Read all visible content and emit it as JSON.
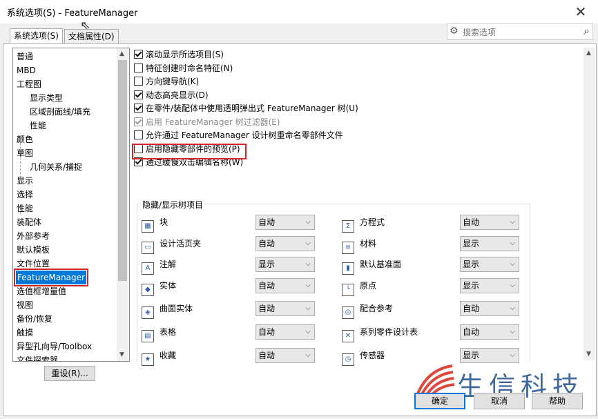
{
  "window": {
    "title": "系统选项(S) - FeatureManager"
  },
  "tabs": [
    {
      "label": "系统选项(S)",
      "active": true
    },
    {
      "label": "文档属性(D)",
      "active": false
    }
  ],
  "search": {
    "placeholder": "搜索选项"
  },
  "nav": {
    "items": [
      {
        "label": "普通",
        "sub": false
      },
      {
        "label": "MBD",
        "sub": false
      },
      {
        "label": "工程图",
        "sub": false
      },
      {
        "label": "显示类型",
        "sub": true
      },
      {
        "label": "区域剖面线/填充",
        "sub": true
      },
      {
        "label": "性能",
        "sub": true
      },
      {
        "label": "颜色",
        "sub": false
      },
      {
        "label": "草图",
        "sub": false
      },
      {
        "label": "几何关系/捕捉",
        "sub": true
      },
      {
        "label": "显示",
        "sub": false
      },
      {
        "label": "选择",
        "sub": false
      },
      {
        "label": "性能",
        "sub": false
      },
      {
        "label": "装配体",
        "sub": false
      },
      {
        "label": "外部参考",
        "sub": false
      },
      {
        "label": "默认模板",
        "sub": false
      },
      {
        "label": "文件位置",
        "sub": false
      },
      {
        "label": "FeatureManager",
        "sub": false,
        "selected": true
      },
      {
        "label": "选值框增量值",
        "sub": false
      },
      {
        "label": "视图",
        "sub": false
      },
      {
        "label": "备份/恢复",
        "sub": false
      },
      {
        "label": "触摸",
        "sub": false
      },
      {
        "label": "异型孔向导/Toolbox",
        "sub": false
      },
      {
        "label": "文件探索器",
        "sub": false
      }
    ],
    "reset_label": "重设(R)..."
  },
  "options": [
    {
      "label": "滚动显示所选项目(S)",
      "checked": true,
      "disabled": false
    },
    {
      "label": "特征创建时命名特征(N)",
      "checked": false,
      "disabled": false
    },
    {
      "label": "方向键导航(K)",
      "checked": false,
      "disabled": false
    },
    {
      "label": "动态高亮显示(D)",
      "checked": true,
      "disabled": false
    },
    {
      "label": "在零件/装配体中使用透明弹出式 FeatureManager 树(U)",
      "checked": true,
      "disabled": false
    },
    {
      "label": "启用 FeatureManager 树过滤器(E)",
      "checked": true,
      "disabled": true
    },
    {
      "label": "允许通过 FeatureManager 设计树重命名零部件文件",
      "checked": false,
      "disabled": false
    },
    {
      "label": "启用隐藏零部件的预览(P)",
      "checked": false,
      "disabled": false
    },
    {
      "label": "通过缓慢双击编辑名称(W)",
      "checked": true,
      "disabled": false
    }
  ],
  "tree_items": {
    "title": "隐藏/显示树项目",
    "left": [
      {
        "label": "块",
        "icon": "block-icon",
        "value": "自动"
      },
      {
        "label": "设计活页夹",
        "icon": "binder-icon",
        "value": "自动"
      },
      {
        "label": "注解",
        "icon": "annotation-icon",
        "value": "显示"
      },
      {
        "label": "实体",
        "icon": "solid-body-icon",
        "value": "自动"
      },
      {
        "label": "曲面实体",
        "icon": "surface-body-icon",
        "value": "自动"
      },
      {
        "label": "表格",
        "icon": "table-icon",
        "value": "自动"
      },
      {
        "label": "收藏",
        "icon": "favorites-icon",
        "value": "自动"
      }
    ],
    "right": [
      {
        "label": "方程式",
        "icon": "equation-icon",
        "value": "自动"
      },
      {
        "label": "材料",
        "icon": "material-icon",
        "value": "显示"
      },
      {
        "label": "默认基准面",
        "icon": "plane-icon",
        "value": "显示"
      },
      {
        "label": "原点",
        "icon": "origin-icon",
        "value": "显示"
      },
      {
        "label": "配合参考",
        "icon": "mate-reference-icon",
        "value": "自动"
      },
      {
        "label": "系列零件设计表",
        "icon": "design-table-icon",
        "value": "自动"
      },
      {
        "label": "传感器",
        "icon": "sensor-icon",
        "value": "显示"
      }
    ]
  },
  "buttons": {
    "ok": "确定",
    "cancel": "取消",
    "help": "帮助"
  },
  "watermark": {
    "text": "生信科技"
  },
  "colors": {
    "selection": "#0078d7",
    "highlight": "#d3262b"
  }
}
